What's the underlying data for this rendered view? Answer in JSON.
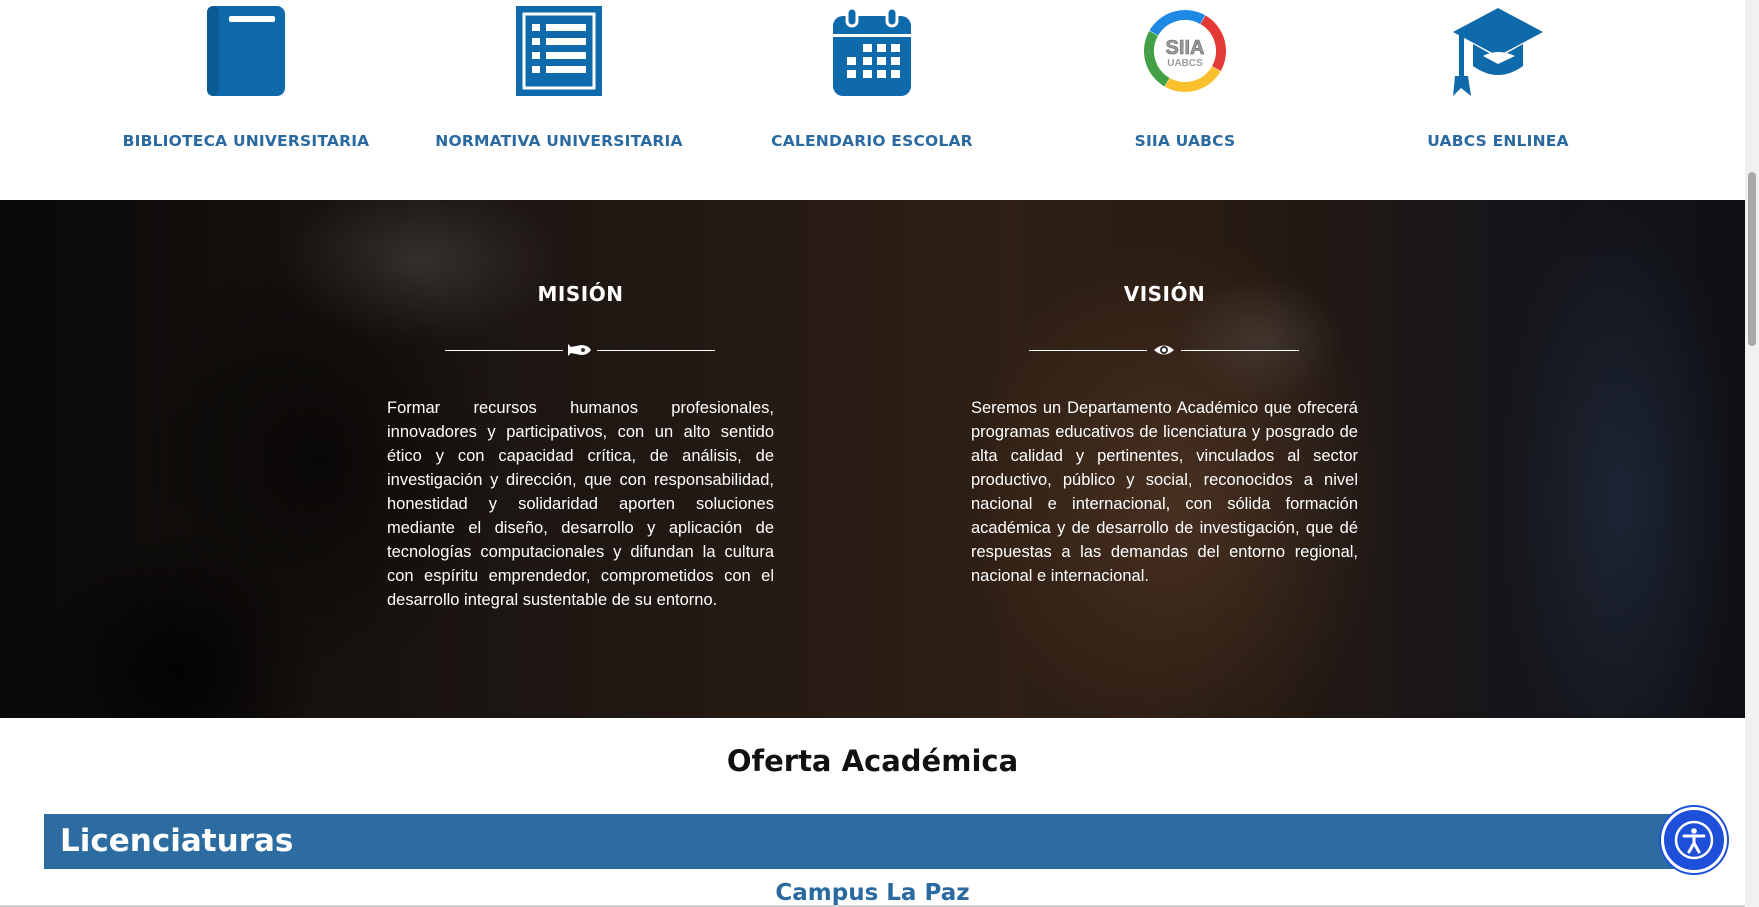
{
  "quick_links": [
    {
      "label": "BIBLIOTECA UNIVERSITARIA",
      "icon": "book-icon"
    },
    {
      "label": "NORMATIVA UNIVERSITARIA",
      "icon": "list-document-icon"
    },
    {
      "label": "CALENDARIO ESCOLAR",
      "icon": "calendar-icon"
    },
    {
      "label": "SIIA UABCS",
      "icon": "siia-logo"
    },
    {
      "label": "UABCS ENLINEA",
      "icon": "graduation-cap-icon"
    }
  ],
  "siia_logo_text": {
    "line1": "SIIA",
    "line2": "UABCS"
  },
  "mision": {
    "title": "MISIÓN",
    "icon": "rocket-icon",
    "text": "Formar recursos humanos profesionales, innovadores y participativos, con un alto sentido ético y con capacidad crítica, de análisis, de investigación y dirección, que con responsabilidad, honestidad y solidaridad aporten soluciones mediante el diseño, desarrollo y aplicación de tecnologías computacionales y difundan la cultura con espíritu emprendedor, comprometidos con el desarrollo integral sustentable de su entorno."
  },
  "vision": {
    "title": "VISIÓN",
    "icon": "eye-icon",
    "text": "Seremos un Departamento Académico que ofrecerá programas educativos de licenciatura y posgrado de alta calidad y pertinentes, vinculados al sector productivo, público y social, reconocidos a nivel nacional e internacional, con sólida formación académica y de desarrollo de investigación, que dé respuestas a las demandas del entorno regional, nacional e internacional."
  },
  "oferta": {
    "title": "Oferta Académica",
    "section_label": "Licenciaturas",
    "campus": "Campus La Paz"
  },
  "accessibility": {
    "icon": "accessibility-icon"
  },
  "colors": {
    "brand_blue": "#2c6ca0",
    "link_blue": "#2a6aa0",
    "icon_blue": "#0f6aab",
    "a11y_blue": "#1d4fd8"
  }
}
